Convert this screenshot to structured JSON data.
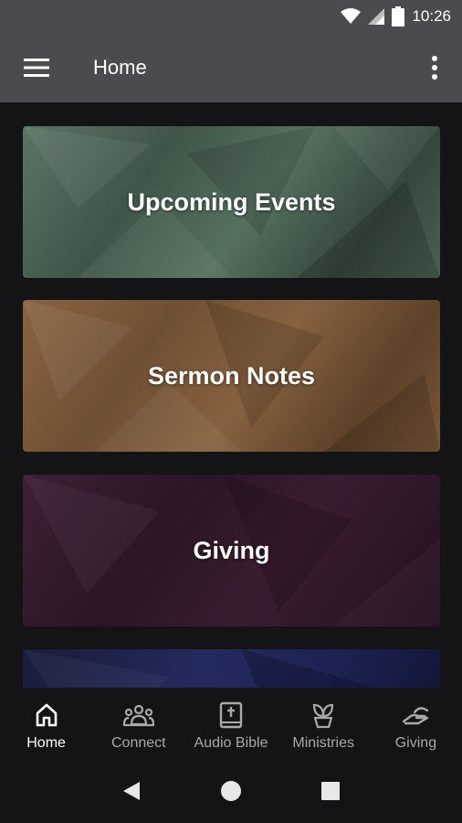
{
  "status_bar": {
    "time": "10:26"
  },
  "app_bar": {
    "title": "Home",
    "menu_icon": "hamburger-menu-icon",
    "overflow_icon": "more-vertical-icon"
  },
  "cards": [
    {
      "label": "Upcoming Events",
      "color": "#4f6657"
    },
    {
      "label": "Sermon Notes",
      "color": "#7a5739"
    },
    {
      "label": "Giving",
      "color": "#33192c"
    },
    {
      "label": "",
      "color": "#1f2550"
    }
  ],
  "bottom_nav": {
    "items": [
      {
        "label": "Home",
        "icon": "home-icon",
        "active": true
      },
      {
        "label": "Connect",
        "icon": "group-icon",
        "active": false
      },
      {
        "label": "Audio Bible",
        "icon": "bible-icon",
        "active": false
      },
      {
        "label": "Ministries",
        "icon": "plant-icon",
        "active": false
      },
      {
        "label": "Giving",
        "icon": "giving-hand-icon",
        "active": false
      }
    ]
  },
  "colors": {
    "app_bar": "#4a4a4f",
    "background": "#141416",
    "nav_active": "#ffffff",
    "nav_inactive": "#a9a9ad"
  }
}
